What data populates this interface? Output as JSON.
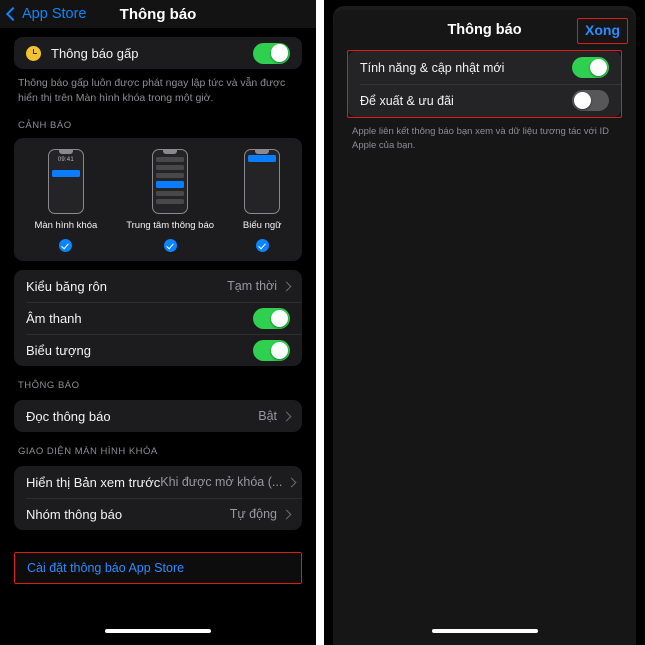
{
  "left": {
    "nav": {
      "back_label": "App Store",
      "back_icon": "chevron-left-icon",
      "title": "Thông báo"
    },
    "urgent": {
      "icon": "clock-icon",
      "label": "Thông báo gấp",
      "toggle": "on",
      "footnote": "Thông báo gấp luôn được phát ngay lập tức và vẫn được hiển thị trên Màn hình khóa trong một giờ."
    },
    "alerts_section_header": "CẢNH BÁO",
    "alert_styles": [
      {
        "caption": "Màn hình khóa",
        "time": "09:41",
        "selected": true,
        "preview": "lockscreen"
      },
      {
        "caption": "Trung tâm thông báo",
        "time": "",
        "selected": true,
        "preview": "notification-center"
      },
      {
        "caption": "Biểu ngữ",
        "time": "",
        "selected": true,
        "preview": "banner"
      }
    ],
    "alert_rows": [
      {
        "label": "Kiểu băng rôn",
        "value": "Tạm thời",
        "type": "disclosure"
      },
      {
        "label": "Âm thanh",
        "value": "",
        "type": "toggle",
        "toggle": "on"
      },
      {
        "label": "Biểu tượng",
        "value": "",
        "type": "toggle",
        "toggle": "on"
      }
    ],
    "notifications_section_header": "THÔNG BÁO",
    "notification_rows": [
      {
        "label": "Đọc thông báo",
        "value": "Bật",
        "type": "disclosure"
      }
    ],
    "lockscreen_section_header": "GIAO DIỆN MÀN HÌNH KHÓA",
    "lockscreen_rows": [
      {
        "label": "Hiển thị Bản xem trước",
        "value": "Khi được mở khóa (...",
        "type": "disclosure"
      },
      {
        "label": "Nhóm thông báo",
        "value": "Tự động",
        "type": "disclosure"
      }
    ],
    "app_settings_link": "Cài đặt thông báo App Store"
  },
  "right": {
    "nav": {
      "title": "Thông báo",
      "done_label": "Xong"
    },
    "rows": [
      {
        "label": "Tính năng & cập nhật mới",
        "toggle": "on"
      },
      {
        "label": "Để xuất & ưu đãi",
        "toggle": "off"
      }
    ],
    "footnote": "Apple liên kết thông báo bạn xem và dữ liệu tương tác với ID Apple của bạn."
  },
  "colors": {
    "accent_blue": "#0a84ff",
    "link_blue": "#2b8cff",
    "toggle_on_green": "#2fd04f",
    "toggle_off_gray": "#57575a",
    "annotation_red": "#e01b1b",
    "card_bg": "#1c1c1e",
    "screen_bg": "#000000"
  }
}
